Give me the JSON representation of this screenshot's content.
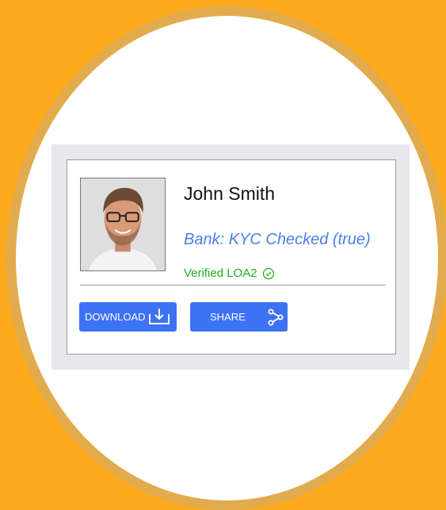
{
  "profile": {
    "name": "John Smith",
    "bank_status": "Bank: KYC Checked (true)",
    "verification": "Verified LOA2"
  },
  "actions": {
    "download_label": "DOWNLOAD",
    "share_label": "SHARE"
  },
  "icons": {
    "avatar": "person-photo",
    "verified": "check-circle-icon",
    "download": "download-icon",
    "share": "share-icon"
  },
  "colors": {
    "background": "#FDAA1F",
    "ring": "#E2AB4D",
    "button": "#3D72F5",
    "bank_text": "#4A7FE8",
    "verified_text": "#1FAE1F"
  }
}
